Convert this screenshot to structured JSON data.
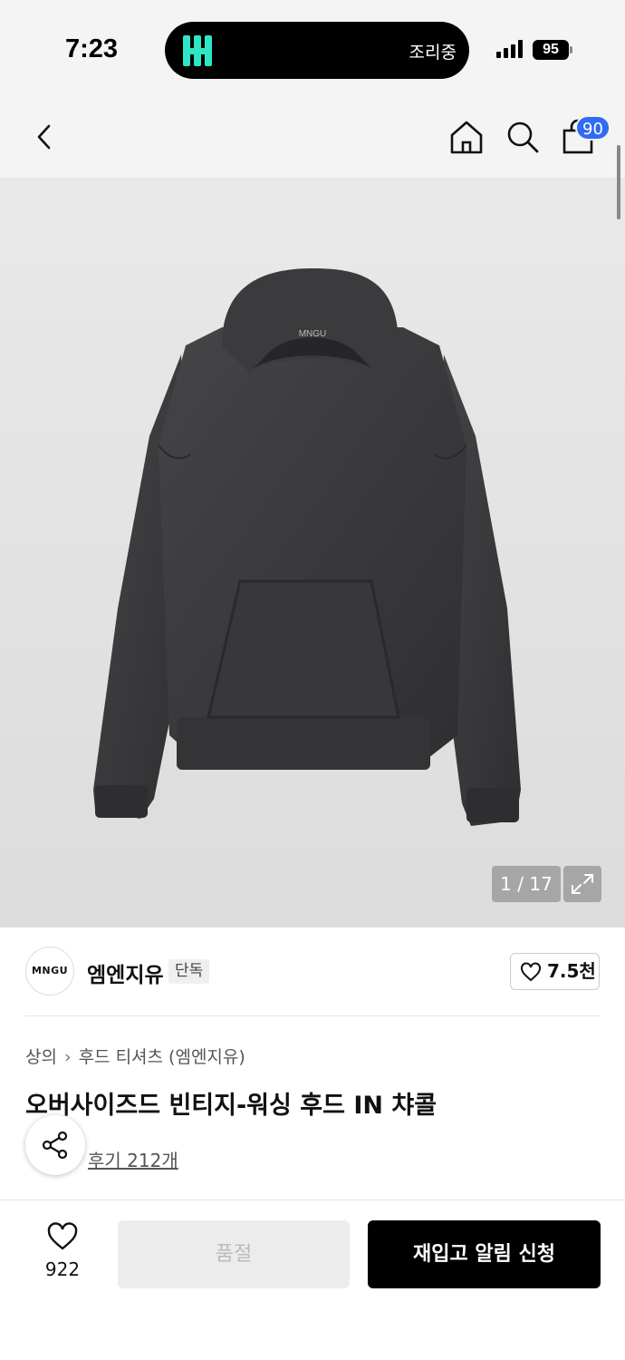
{
  "status_bar": {
    "time": "7:23",
    "island_status": "조리중",
    "battery": "95"
  },
  "header": {
    "cart_count": "90",
    "icons": [
      "back-icon",
      "home-icon",
      "search-icon",
      "cart-icon"
    ]
  },
  "gallery": {
    "counter": "1 / 17",
    "hoodie_label": "MNGU"
  },
  "brand": {
    "logo_text": "MNGU",
    "name": "엠엔지유",
    "tag": "단독",
    "likes": "7.5천"
  },
  "product": {
    "breadcrumb": [
      "상의",
      "후드 티셔츠 (엠엔지유)"
    ],
    "title": "오버사이즈드 빈티지-워싱 후드 IN 챠콜",
    "reviews": "후기 212개"
  },
  "bottom_bar": {
    "wish_count": "922",
    "soldout_label": "품절",
    "restock_label": "재입고 알림 신청"
  },
  "colors": {
    "accent_badge": "#2f6bf3",
    "primary_button": "#000000",
    "hoodie": "#3a3a3c"
  }
}
